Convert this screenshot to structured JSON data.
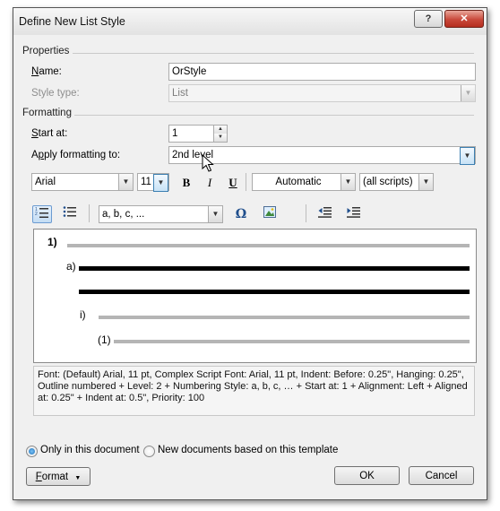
{
  "window": {
    "title": "Define New List Style",
    "help_glyph": "?",
    "close_glyph": "✕"
  },
  "properties": {
    "section": "Properties",
    "name_label_u": "N",
    "name_label_rest": "ame:",
    "name_value": "OrStyle",
    "style_type_label": "Style type:",
    "style_type_value": "List"
  },
  "formatting": {
    "section": "Formatting",
    "start_at_label_u": "S",
    "start_at_label_rest": "tart at:",
    "start_at_value": "1",
    "apply_label_pre": "A",
    "apply_label_u": "p",
    "apply_label_rest": "ply formatting to:",
    "apply_value": "2nd level",
    "font_name": "Arial",
    "font_size": "11",
    "bold": "B",
    "italic": "I",
    "underline": "U",
    "color_value": "Automatic",
    "script_value": "(all scripts)",
    "numbering_style": "a, b, c, ...",
    "omega": "Ω"
  },
  "preview": {
    "level1": "1)",
    "level2": "a)",
    "level3": "i)",
    "level4": "(1)"
  },
  "description": "Font: (Default) Arial, 11 pt, Complex Script Font: Arial, 11 pt, Indent: Before: 0.25\", Hanging: 0.25\", Outline numbered + Level: 2 + Numbering Style: a, b, c, … + Start at: 1 + Alignment: Left + Aligned at: 0.25\" + Indent at: 0.5\", Priority: 100",
  "options": {
    "only_doc": "Only in this document",
    "new_docs": "New documents based on this template",
    "selected": "only_doc"
  },
  "buttons": {
    "format_u": "F",
    "format_rest": "ormat",
    "format_arrow": "▼",
    "ok": "OK",
    "cancel": "Cancel"
  },
  "icons": {
    "dropdown": "▼",
    "spin_up": "▲",
    "spin_down": "▼"
  }
}
